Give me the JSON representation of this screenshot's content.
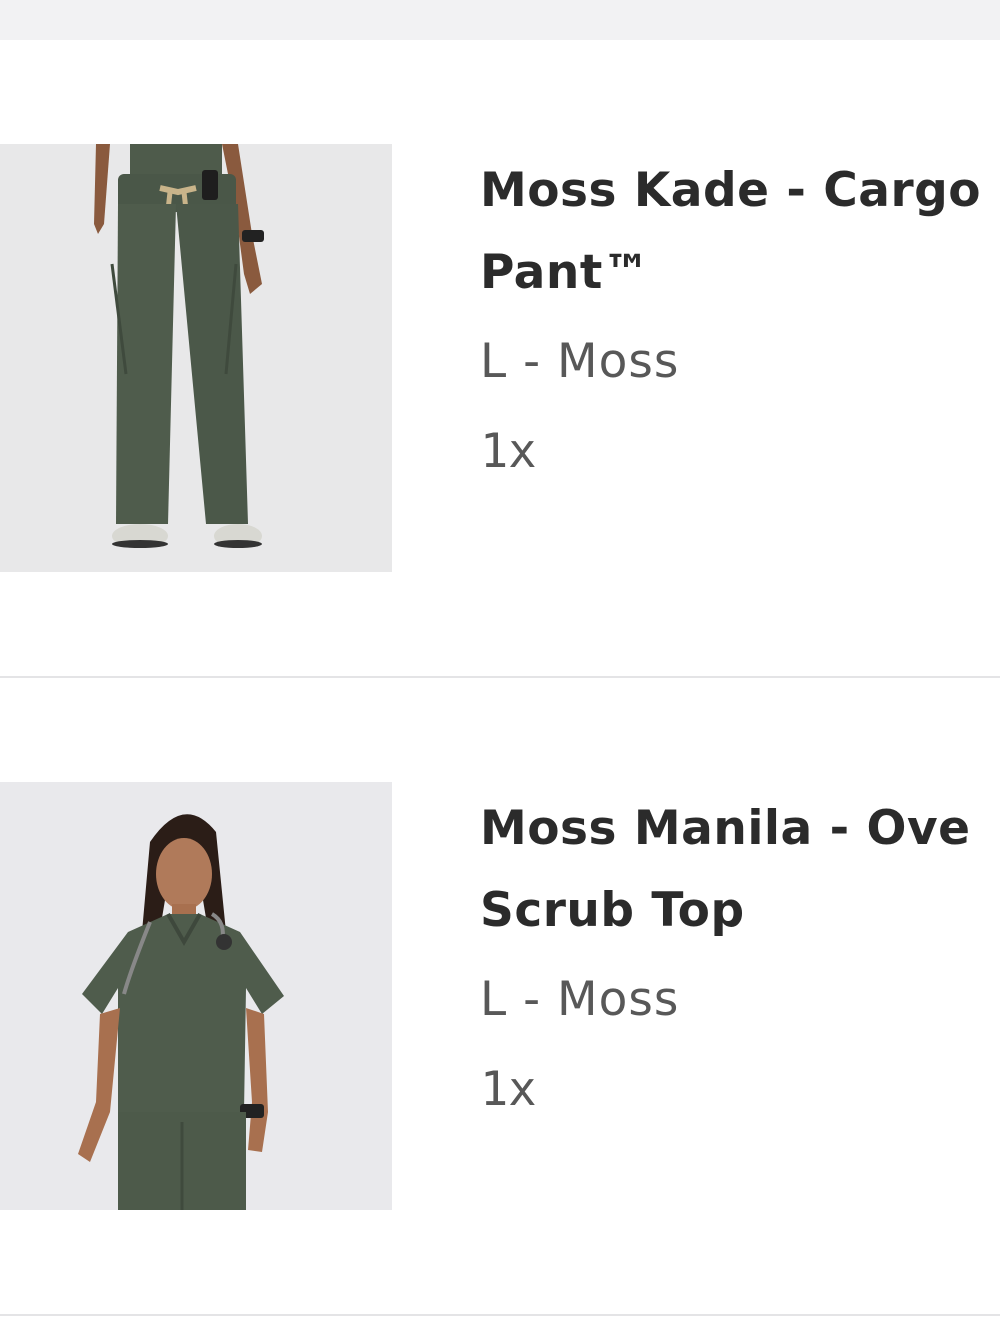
{
  "cart": {
    "items": [
      {
        "title_line1": "Moss Kade - Cargo",
        "title_line2": "Pant™",
        "variant": "L - Moss",
        "quantity": "1x",
        "image_icon": "product-photo-pants"
      },
      {
        "title_line1": "Moss Manila - Ove",
        "title_line2": "Scrub Top",
        "variant": "L - Moss",
        "quantity": "1x",
        "image_icon": "product-photo-top"
      }
    ]
  },
  "colors": {
    "scrub": "#4d5a4a",
    "photo_bg": "#e9e9ea"
  }
}
